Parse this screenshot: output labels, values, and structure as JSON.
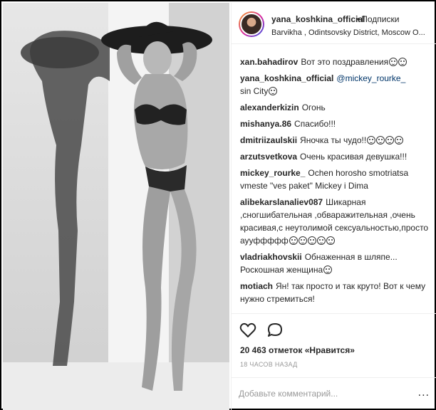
{
  "header": {
    "username": "yana_koshkina_official",
    "separator": "•",
    "follow_label": "Подписки",
    "location": "Barvikha , Odintsovsky District, Moscow O..."
  },
  "comments": [
    {
      "user": "xan.bahadirov",
      "text": "Вот это поздравления",
      "emoji": 2
    },
    {
      "user": "yana_koshkina_official",
      "mention": "@mickey_rourke_",
      "text": "sin City",
      "emoji": 1
    },
    {
      "user": "alexanderkizin",
      "text": "Огонь",
      "emoji": 0
    },
    {
      "user": "mishanya.86",
      "text": "Спасибо!!!",
      "emoji": 0
    },
    {
      "user": "dmitriizaulskii",
      "text": "Яночка ты чудо!!",
      "emoji": 4
    },
    {
      "user": "arzutsvetkova",
      "text": "Очень красивая девушка!!!",
      "emoji": 0
    },
    {
      "user": "mickey_rourke_",
      "text": "Ochen horosho smotriatsa vmeste \"ves paket\" Mickey i Dima",
      "emoji": 0
    },
    {
      "user": "alibekarslanaliev087",
      "text": "Шикарная ,сногшибательная ,обваражительная ,очень красивая,с неутолимой сексуальностью,просто аууффффф",
      "emoji": 5
    },
    {
      "user": "vladriakhovskii",
      "text": "Обнаженная в шляпе... Роскошная женщина",
      "emoji": 1
    },
    {
      "user": "motiach",
      "text": "Ян! так просто и так круто! Вот к чему нужно стремиться!",
      "emoji": 0
    }
  ],
  "actions": {
    "like_icon": "heart-icon",
    "comment_icon": "comment-icon",
    "likes_text": "20 463 отметок «Нравится»",
    "time_text": "18 ЧАСОВ НАЗАД"
  },
  "add_comment": {
    "placeholder": "Добавьте комментарий...",
    "more_label": "..."
  }
}
